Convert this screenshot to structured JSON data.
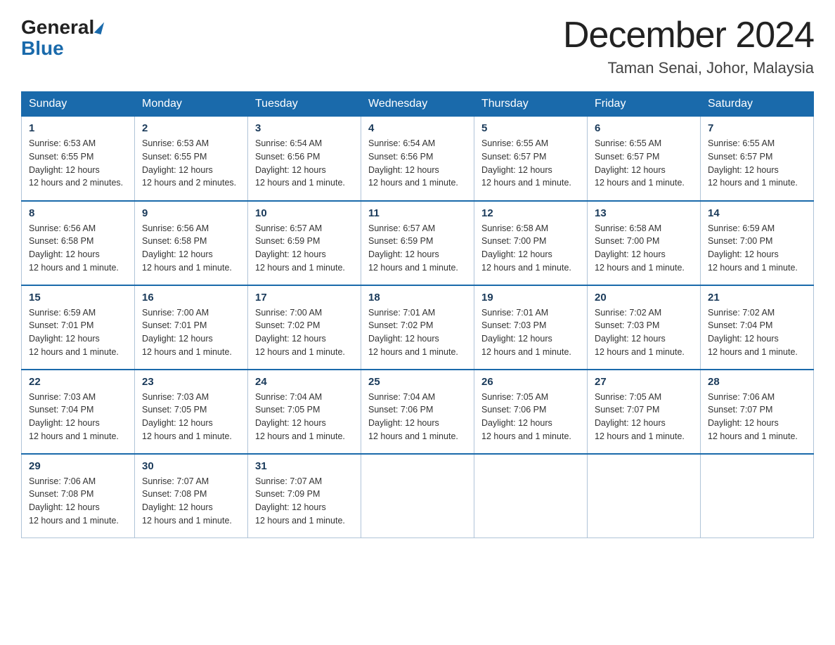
{
  "header": {
    "logo_general": "General",
    "logo_blue": "Blue",
    "title": "December 2024",
    "subtitle": "Taman Senai, Johor, Malaysia"
  },
  "days_of_week": [
    "Sunday",
    "Monday",
    "Tuesday",
    "Wednesday",
    "Thursday",
    "Friday",
    "Saturday"
  ],
  "weeks": [
    [
      {
        "day": "1",
        "sunrise": "6:53 AM",
        "sunset": "6:55 PM",
        "daylight": "12 hours and 2 minutes."
      },
      {
        "day": "2",
        "sunrise": "6:53 AM",
        "sunset": "6:55 PM",
        "daylight": "12 hours and 2 minutes."
      },
      {
        "day": "3",
        "sunrise": "6:54 AM",
        "sunset": "6:56 PM",
        "daylight": "12 hours and 1 minute."
      },
      {
        "day": "4",
        "sunrise": "6:54 AM",
        "sunset": "6:56 PM",
        "daylight": "12 hours and 1 minute."
      },
      {
        "day": "5",
        "sunrise": "6:55 AM",
        "sunset": "6:57 PM",
        "daylight": "12 hours and 1 minute."
      },
      {
        "day": "6",
        "sunrise": "6:55 AM",
        "sunset": "6:57 PM",
        "daylight": "12 hours and 1 minute."
      },
      {
        "day": "7",
        "sunrise": "6:55 AM",
        "sunset": "6:57 PM",
        "daylight": "12 hours and 1 minute."
      }
    ],
    [
      {
        "day": "8",
        "sunrise": "6:56 AM",
        "sunset": "6:58 PM",
        "daylight": "12 hours and 1 minute."
      },
      {
        "day": "9",
        "sunrise": "6:56 AM",
        "sunset": "6:58 PM",
        "daylight": "12 hours and 1 minute."
      },
      {
        "day": "10",
        "sunrise": "6:57 AM",
        "sunset": "6:59 PM",
        "daylight": "12 hours and 1 minute."
      },
      {
        "day": "11",
        "sunrise": "6:57 AM",
        "sunset": "6:59 PM",
        "daylight": "12 hours and 1 minute."
      },
      {
        "day": "12",
        "sunrise": "6:58 AM",
        "sunset": "7:00 PM",
        "daylight": "12 hours and 1 minute."
      },
      {
        "day": "13",
        "sunrise": "6:58 AM",
        "sunset": "7:00 PM",
        "daylight": "12 hours and 1 minute."
      },
      {
        "day": "14",
        "sunrise": "6:59 AM",
        "sunset": "7:00 PM",
        "daylight": "12 hours and 1 minute."
      }
    ],
    [
      {
        "day": "15",
        "sunrise": "6:59 AM",
        "sunset": "7:01 PM",
        "daylight": "12 hours and 1 minute."
      },
      {
        "day": "16",
        "sunrise": "7:00 AM",
        "sunset": "7:01 PM",
        "daylight": "12 hours and 1 minute."
      },
      {
        "day": "17",
        "sunrise": "7:00 AM",
        "sunset": "7:02 PM",
        "daylight": "12 hours and 1 minute."
      },
      {
        "day": "18",
        "sunrise": "7:01 AM",
        "sunset": "7:02 PM",
        "daylight": "12 hours and 1 minute."
      },
      {
        "day": "19",
        "sunrise": "7:01 AM",
        "sunset": "7:03 PM",
        "daylight": "12 hours and 1 minute."
      },
      {
        "day": "20",
        "sunrise": "7:02 AM",
        "sunset": "7:03 PM",
        "daylight": "12 hours and 1 minute."
      },
      {
        "day": "21",
        "sunrise": "7:02 AM",
        "sunset": "7:04 PM",
        "daylight": "12 hours and 1 minute."
      }
    ],
    [
      {
        "day": "22",
        "sunrise": "7:03 AM",
        "sunset": "7:04 PM",
        "daylight": "12 hours and 1 minute."
      },
      {
        "day": "23",
        "sunrise": "7:03 AM",
        "sunset": "7:05 PM",
        "daylight": "12 hours and 1 minute."
      },
      {
        "day": "24",
        "sunrise": "7:04 AM",
        "sunset": "7:05 PM",
        "daylight": "12 hours and 1 minute."
      },
      {
        "day": "25",
        "sunrise": "7:04 AM",
        "sunset": "7:06 PM",
        "daylight": "12 hours and 1 minute."
      },
      {
        "day": "26",
        "sunrise": "7:05 AM",
        "sunset": "7:06 PM",
        "daylight": "12 hours and 1 minute."
      },
      {
        "day": "27",
        "sunrise": "7:05 AM",
        "sunset": "7:07 PM",
        "daylight": "12 hours and 1 minute."
      },
      {
        "day": "28",
        "sunrise": "7:06 AM",
        "sunset": "7:07 PM",
        "daylight": "12 hours and 1 minute."
      }
    ],
    [
      {
        "day": "29",
        "sunrise": "7:06 AM",
        "sunset": "7:08 PM",
        "daylight": "12 hours and 1 minute."
      },
      {
        "day": "30",
        "sunrise": "7:07 AM",
        "sunset": "7:08 PM",
        "daylight": "12 hours and 1 minute."
      },
      {
        "day": "31",
        "sunrise": "7:07 AM",
        "sunset": "7:09 PM",
        "daylight": "12 hours and 1 minute."
      },
      null,
      null,
      null,
      null
    ]
  ]
}
